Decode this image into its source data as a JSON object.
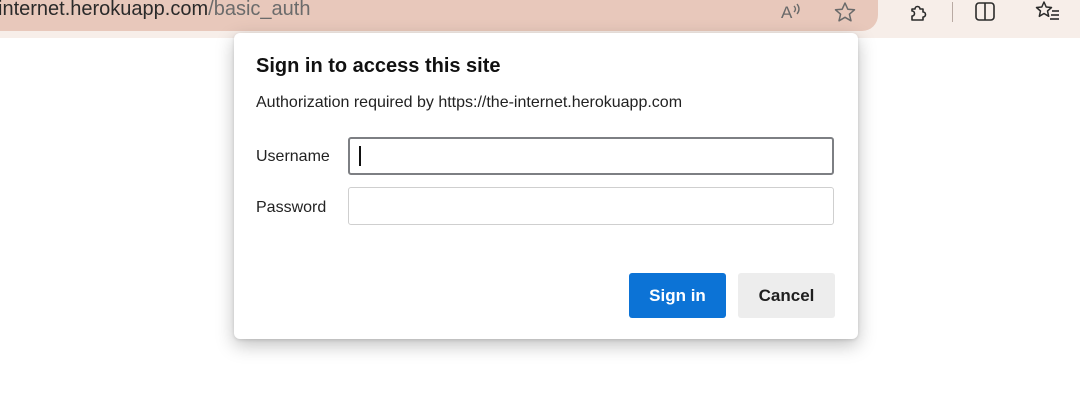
{
  "browser": {
    "url_host": "internet.herokuapp.com",
    "url_path": "/basic_auth",
    "icons": [
      "read-aloud-icon",
      "favorite-star-icon",
      "extensions-icon",
      "split-screen-icon",
      "favorites-list-icon"
    ]
  },
  "dialog": {
    "title": "Sign in to access this site",
    "subtitle": "Authorization required by https://the-internet.herokuapp.com",
    "username_label": "Username",
    "username_value": "",
    "password_label": "Password",
    "password_value": "",
    "signin_label": "Sign in",
    "cancel_label": "Cancel"
  },
  "colors": {
    "address_bar": "#e8c8bb",
    "primary_button": "#0c73d6",
    "secondary_button": "#ededed"
  }
}
